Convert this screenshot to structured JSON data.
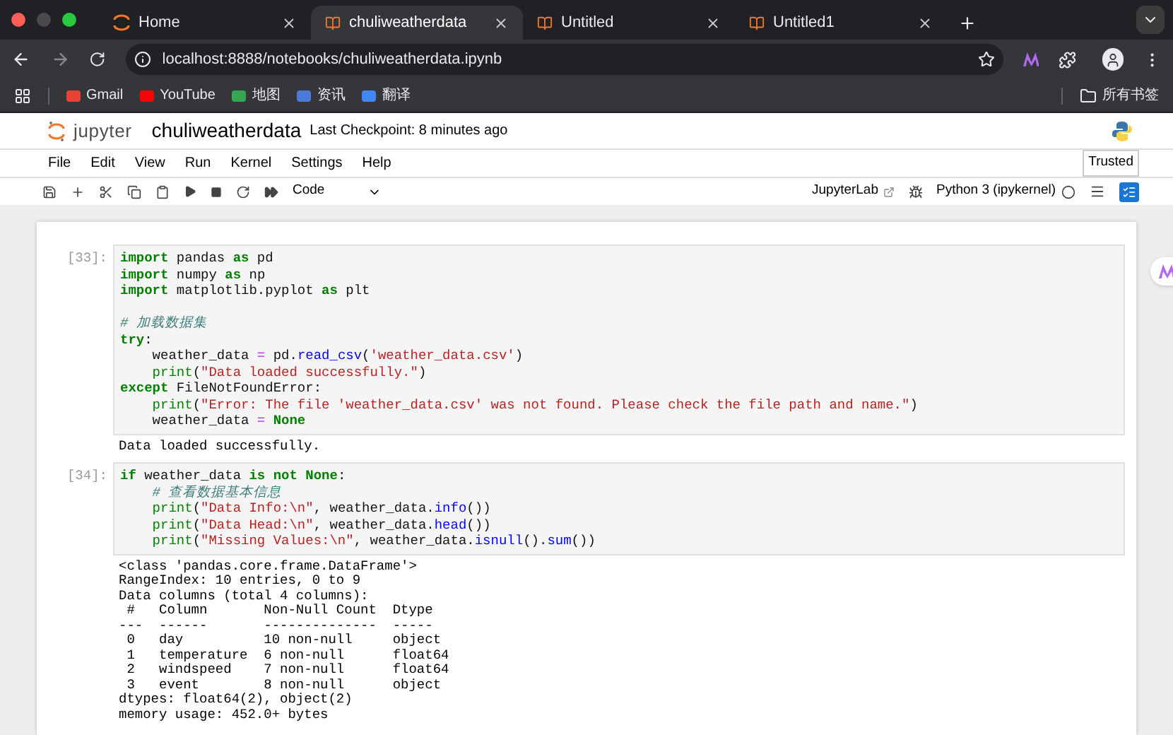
{
  "browser": {
    "tabs": [
      {
        "label": "Home",
        "kind": "home",
        "selected": false
      },
      {
        "label": "chuliweatherdata",
        "kind": "notebook",
        "selected": true
      },
      {
        "label": "Untitled",
        "kind": "notebook",
        "selected": false
      },
      {
        "label": "Untitled1",
        "kind": "notebook",
        "selected": false
      }
    ],
    "address": "localhost:8888/notebooks/chuliweatherdata.ipynb",
    "bookmarks": [
      {
        "label": "Gmail",
        "color": "#ea4335"
      },
      {
        "label": "YouTube",
        "color": "#ff0000"
      },
      {
        "label": "地图",
        "color": "#34a853"
      },
      {
        "label": "资讯",
        "color": "#4a7bd8"
      },
      {
        "label": "翻译",
        "color": "#4285f4"
      }
    ],
    "all_bookmarks": "所有书签"
  },
  "jupyter": {
    "logo": "jupyter",
    "title": "chuliweatherdata",
    "checkpoint": "Last Checkpoint: 8 minutes ago",
    "menu": [
      "File",
      "Edit",
      "View",
      "Run",
      "Kernel",
      "Settings",
      "Help"
    ],
    "trusted": "Trusted",
    "cell_type": "Code",
    "lab_link": "JupyterLab",
    "kernel": "Python 3 (ipykernel)"
  },
  "cells": [
    {
      "prompt": "[33]:",
      "code": [
        {
          "kind": "code",
          "tokens": [
            {
              "kind": "kw",
              "text": "import"
            },
            {
              "kind": "plain",
              "text": " pandas "
            },
            {
              "kind": "kw",
              "text": "as"
            },
            {
              "kind": "plain",
              "text": " pd"
            }
          ]
        },
        {
          "kind": "code",
          "tokens": [
            {
              "kind": "kw",
              "text": "import"
            },
            {
              "kind": "plain",
              "text": " numpy "
            },
            {
              "kind": "kw",
              "text": "as"
            },
            {
              "kind": "plain",
              "text": " np"
            }
          ]
        },
        {
          "kind": "code",
          "tokens": [
            {
              "kind": "kw",
              "text": "import"
            },
            {
              "kind": "plain",
              "text": " matplotlib.pyplot "
            },
            {
              "kind": "kw",
              "text": "as"
            },
            {
              "kind": "plain",
              "text": " plt"
            }
          ]
        },
        {
          "kind": "blank"
        },
        {
          "kind": "code",
          "tokens": [
            {
              "kind": "comment",
              "text": "# 加载数据集"
            }
          ]
        },
        {
          "kind": "code",
          "tokens": [
            {
              "kind": "kw",
              "text": "try"
            },
            {
              "kind": "plain",
              "text": ":"
            }
          ]
        },
        {
          "kind": "code",
          "tokens": [
            {
              "kind": "plain",
              "text": "    weather_data "
            },
            {
              "kind": "op",
              "text": "="
            },
            {
              "kind": "plain",
              "text": " pd."
            },
            {
              "kind": "fn",
              "text": "read_csv"
            },
            {
              "kind": "plain",
              "text": "("
            },
            {
              "kind": "str",
              "text": "'weather_data.csv'"
            },
            {
              "kind": "plain",
              "text": ")"
            }
          ]
        },
        {
          "kind": "code",
          "tokens": [
            {
              "kind": "builtin",
              "text": "    print"
            },
            {
              "kind": "plain",
              "text": "("
            },
            {
              "kind": "str",
              "text": "\"Data loaded successfully.\""
            },
            {
              "kind": "plain",
              "text": ")"
            }
          ]
        },
        {
          "kind": "code",
          "tokens": [
            {
              "kind": "kw",
              "text": "except"
            },
            {
              "kind": "plain",
              "text": " FileNotFoundError:"
            }
          ]
        },
        {
          "kind": "code",
          "tokens": [
            {
              "kind": "builtin",
              "text": "    print"
            },
            {
              "kind": "plain",
              "text": "("
            },
            {
              "kind": "str",
              "text": "\"Error: The file 'weather_data.csv' was not found. Please check the file path and name.\""
            },
            {
              "kind": "plain",
              "text": ")"
            }
          ]
        },
        {
          "kind": "code",
          "tokens": [
            {
              "kind": "plain",
              "text": "    weather_data "
            },
            {
              "kind": "op",
              "text": "="
            },
            {
              "kind": "kw",
              "text": " None"
            }
          ]
        }
      ],
      "output": [
        "Data loaded successfully."
      ]
    },
    {
      "prompt": "[34]:",
      "code": [
        {
          "kind": "code",
          "tokens": [
            {
              "kind": "kw",
              "text": "if"
            },
            {
              "kind": "plain",
              "text": " weather_data "
            },
            {
              "kind": "kw",
              "text": "is not"
            },
            {
              "kind": "kw",
              "text": " None"
            },
            {
              "kind": "plain",
              "text": ":"
            }
          ]
        },
        {
          "kind": "code",
          "tokens": [
            {
              "kind": "comment",
              "text": "    # 查看数据基本信息"
            }
          ]
        },
        {
          "kind": "code",
          "tokens": [
            {
              "kind": "builtin",
              "text": "    print"
            },
            {
              "kind": "plain",
              "text": "("
            },
            {
              "kind": "str",
              "text": "\"Data Info:\\n\""
            },
            {
              "kind": "plain",
              "text": ", weather_data."
            },
            {
              "kind": "fn",
              "text": "info"
            },
            {
              "kind": "plain",
              "text": "())"
            }
          ]
        },
        {
          "kind": "code",
          "tokens": [
            {
              "kind": "builtin",
              "text": "    print"
            },
            {
              "kind": "plain",
              "text": "("
            },
            {
              "kind": "str",
              "text": "\"Data Head:\\n\""
            },
            {
              "kind": "plain",
              "text": ", weather_data."
            },
            {
              "kind": "fn",
              "text": "head"
            },
            {
              "kind": "plain",
              "text": "())"
            }
          ]
        },
        {
          "kind": "code",
          "tokens": [
            {
              "kind": "builtin",
              "text": "    print"
            },
            {
              "kind": "plain",
              "text": "("
            },
            {
              "kind": "str",
              "text": "\"Missing Values:\\n\""
            },
            {
              "kind": "plain",
              "text": ", weather_data."
            },
            {
              "kind": "fn",
              "text": "isnull"
            },
            {
              "kind": "plain",
              "text": "()."
            },
            {
              "kind": "fn",
              "text": "sum"
            },
            {
              "kind": "plain",
              "text": "())"
            }
          ]
        }
      ],
      "output": [
        "<class 'pandas.core.frame.DataFrame'>",
        "RangeIndex: 10 entries, 0 to 9",
        "Data columns (total 4 columns):",
        " #   Column       Non-Null Count  Dtype  ",
        "---  ------       --------------  -----  ",
        " 0   day          10 non-null     object ",
        " 1   temperature  6 non-null      float64",
        " 2   windspeed    7 non-null      float64",
        " 3   event        8 non-null      object ",
        "dtypes: float64(2), object(2)",
        "memory usage: 452.0+ bytes"
      ]
    }
  ]
}
